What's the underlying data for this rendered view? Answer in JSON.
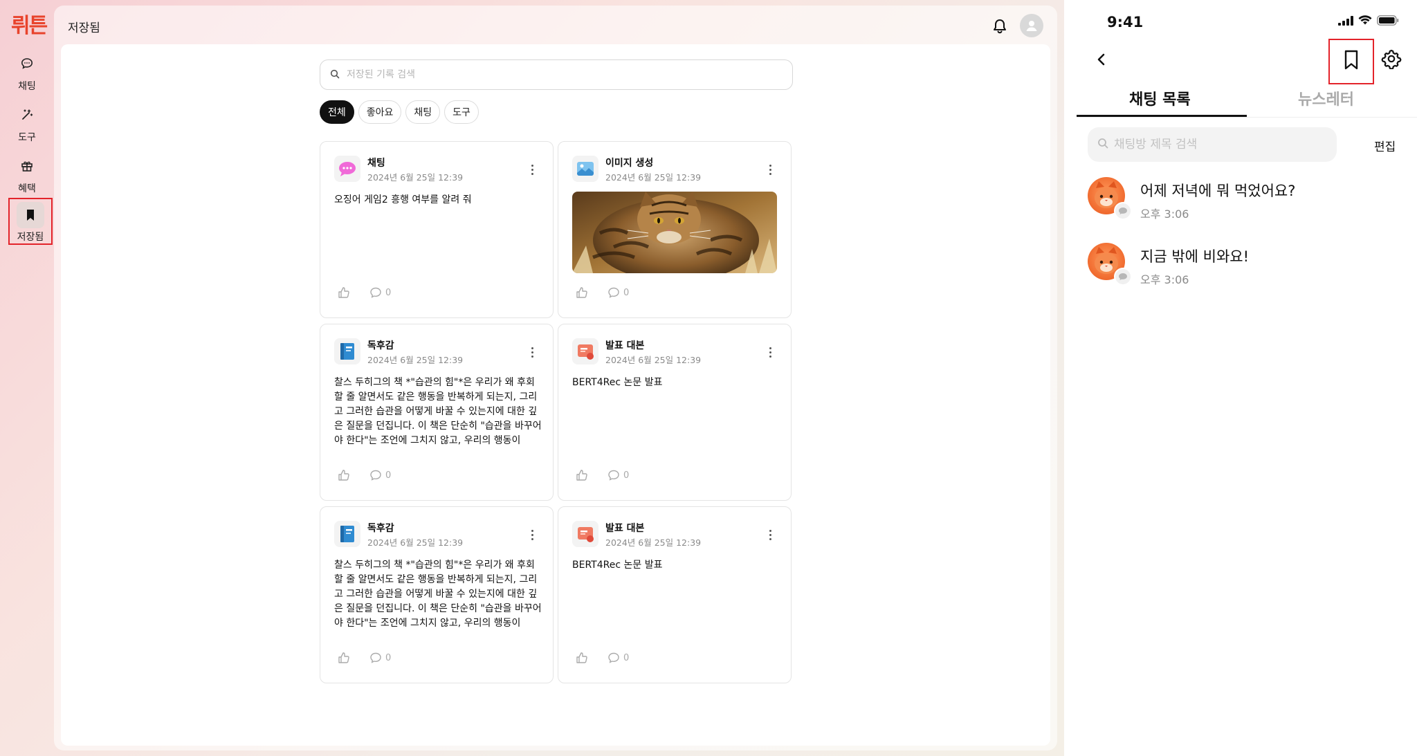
{
  "app": {
    "logo": "뤼튼",
    "page_title": "저장됨"
  },
  "rail": {
    "items": [
      {
        "label": "채팅",
        "icon": "chat-bubble-icon"
      },
      {
        "label": "도구",
        "icon": "magic-wand-icon"
      },
      {
        "label": "혜택",
        "icon": "gift-icon"
      },
      {
        "label": "저장됨",
        "icon": "bookmark-icon",
        "active": true
      }
    ]
  },
  "search": {
    "placeholder": "저장된 기록 검색"
  },
  "filters": [
    "전체",
    "좋아요",
    "채팅",
    "도구"
  ],
  "active_filter": "전체",
  "cards": [
    {
      "title": "채팅",
      "date": "2024년 6월 25일 12:39",
      "body": "오징어 게임2 흥행 여부를 알려 줘",
      "likes": "",
      "comments": "0",
      "icon": "chat-icon"
    },
    {
      "title": "이미지 생성",
      "date": "2024년 6월 25일 12:39",
      "body": "",
      "comments": "0",
      "icon": "image-icon",
      "has_image": true,
      "image_alt": "cat-image"
    },
    {
      "title": "독후감",
      "date": "2024년 6월 25일 12:39",
      "body": "찰스 두히그의 책 *\"습관의 힘\"*은 우리가 왜 후회할 줄 알면서도 같은 행동을 반복하게 되는지, 그리고 그러한 습관을 어떻게 바꿀 수 있는지에 대한 깊은 질문을 던집니다. 이 책은 단순히 \"습관을 바꾸어야 한다\"는 조언에 그치지 않고, 우리의 행동이 어...",
      "comments": "0",
      "icon": "book-icon"
    },
    {
      "title": "발표 대본",
      "date": "2024년 6월 25일 12:39",
      "body": "BERT4Rec 논문 발표",
      "comments": "0",
      "icon": "presentation-icon"
    },
    {
      "title": "독후감",
      "date": "2024년 6월 25일 12:39",
      "body": "찰스 두히그의 책 *\"습관의 힘\"*은 우리가 왜 후회할 줄 알면서도 같은 행동을 반복하게 되는지, 그리고 그러한 습관을 어떻게 바꿀 수 있는지에 대한 깊은 질문을 던집니다. 이 책은 단순히 \"습관을 바꾸어야 한다\"는 조언에 그치지 않고, 우리의 행동이 어...",
      "comments": "0",
      "icon": "book-icon"
    },
    {
      "title": "발표 대본",
      "date": "2024년 6월 25일 12:39",
      "body": "BERT4Rec 논문 발표",
      "comments": "0",
      "icon": "presentation-icon"
    }
  ],
  "phone": {
    "time": "9:41",
    "tabs": [
      "채팅 목록",
      "뉴스레터"
    ],
    "active_tab": "채팅 목록",
    "search_placeholder": "채팅방 제목 검색",
    "edit_label": "편집",
    "chats": [
      {
        "title": "어제 저녁에 뭐 먹었어요?",
        "time": "오후 3:06"
      },
      {
        "title": "지금 밖에 비와요!",
        "time": "오후 3:06"
      }
    ]
  },
  "colors": {
    "logo": "#e8432c",
    "highlight_box": "#e3232a",
    "active_chip": "#111111"
  }
}
